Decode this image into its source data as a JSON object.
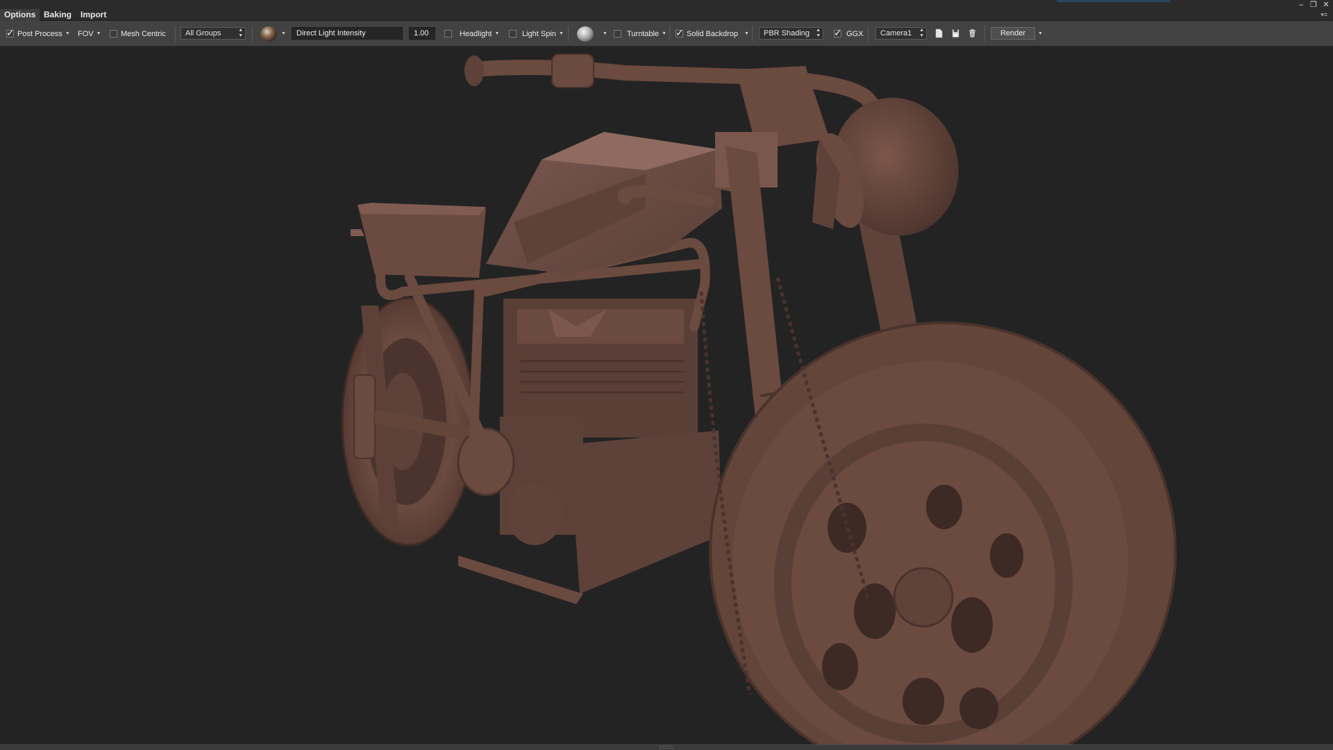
{
  "menubar": {
    "tabs": [
      {
        "label": "Options",
        "active": true
      },
      {
        "label": "Baking",
        "active": false
      },
      {
        "label": "Import",
        "active": false
      }
    ],
    "window_controls": {
      "minimize": "–",
      "restore": "❐",
      "close": "✕"
    },
    "overflow": "▾≡"
  },
  "toolbar": {
    "post_process": {
      "label": "Post Process",
      "checked": true
    },
    "fov": {
      "label": "FOV"
    },
    "mesh_centric": {
      "label": "Mesh Centric",
      "checked": false
    },
    "groups_select": {
      "value": "All Groups"
    },
    "environment_icon": "environment-sphere-icon",
    "light_param_field": {
      "value": "Direct Light Intensity"
    },
    "light_value_field": {
      "value": "1.00"
    },
    "headlight": {
      "label": "Headlight",
      "checked": false
    },
    "light_spin": {
      "label": "Light Spin",
      "checked": false
    },
    "material_icon": "matcap-sphere-icon",
    "turntable": {
      "label": "Turntable",
      "checked": false
    },
    "solid_backdrop": {
      "label": "Solid Backdrop",
      "checked": true
    },
    "shading_select": {
      "value": "PBR Shading"
    },
    "ggx": {
      "label": "GGX",
      "checked": true
    },
    "camera_select": {
      "value": "Camera1"
    },
    "render_button": {
      "label": "Render"
    }
  },
  "viewport": {
    "background": "#232323",
    "model_color": "#6b4a3f",
    "subject": "motorcycle-3d-model"
  }
}
